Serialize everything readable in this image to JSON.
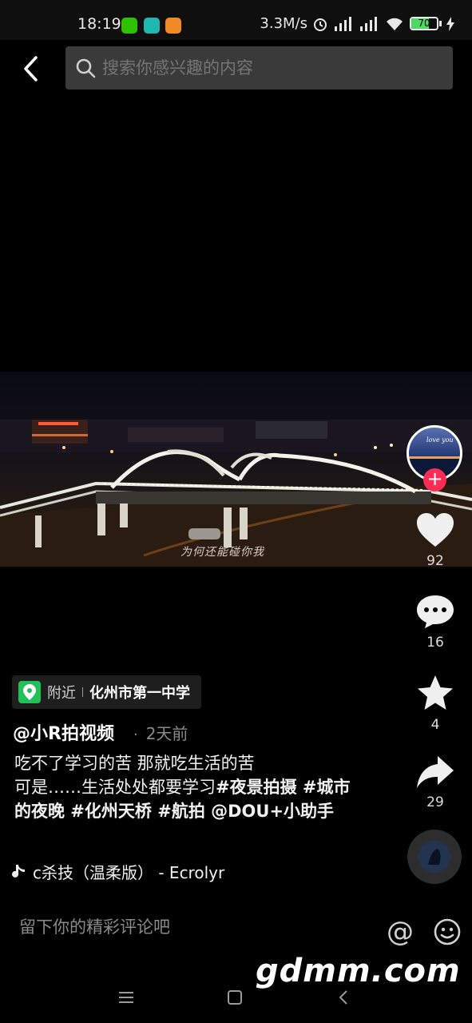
{
  "status_bar": {
    "time": "18:19",
    "net_speed": "3.3M/s",
    "battery": "70",
    "battery_fraction": 0.7
  },
  "search": {
    "placeholder": "搜索你感兴趣的内容"
  },
  "video": {
    "caption_overlay": "为何还能碰你我"
  },
  "actions": {
    "likes": "92",
    "comments": "16",
    "favorites": "4",
    "shares": "29"
  },
  "location": {
    "nearby_label": "附近",
    "place": "化州市第一中学"
  },
  "post": {
    "author": "@小R拍视频",
    "dot": "·",
    "time_ago": "2天前",
    "line1": "吃不了学习的苦 那就吃生活的苦",
    "line2_text": "可是……生活处处都要学习",
    "hashtags": "#夜景拍摄 #城市的夜晚 #化州天桥 #航拍 @DOU+小助手"
  },
  "music": {
    "title": "ϲ杀技（温柔版） - Ecrolyr"
  },
  "comment": {
    "placeholder": "留下你的精彩评论吧",
    "at_symbol": "@"
  },
  "watermark": "gdmm.com",
  "colors": {
    "accent": "#fe2c55",
    "location_green": "#21c15a",
    "battery_green": "#4cd964"
  }
}
